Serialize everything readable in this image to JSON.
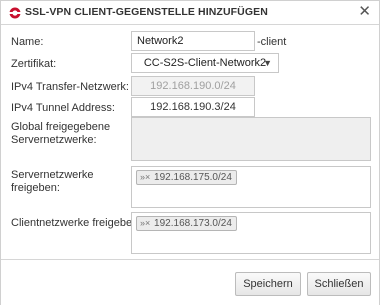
{
  "dialog": {
    "title": "SSL-VPN CLIENT-GEGENSTELLE HINZUFÜGEN",
    "close_symbol": "✕"
  },
  "form": {
    "name_label": "Name:",
    "name_value": "Network2",
    "name_suffix": "-client",
    "certificate_label": "Zertifikat:",
    "certificate_value": "CC-S2S-Client-Network2",
    "transfer_label": "IPv4 Transfer-Netzwerk:",
    "transfer_value": "192.168.190.0/24",
    "tunnel_label": "IPv4 Tunnel Address:",
    "tunnel_value": "192.168.190.3/24",
    "global_label": "Global freigegebene Servernetzwerke:",
    "server_label": "Servernetzwerke freigeben:",
    "server_tags": [
      {
        "remove": "»×",
        "value": "192.168.175.0/24"
      }
    ],
    "client_label": "Clientnetzwerke freigeben:",
    "client_tags": [
      {
        "remove": "»×",
        "value": "192.168.173.0/24"
      }
    ]
  },
  "footer": {
    "save_label": "Speichern",
    "close_label": "Schließen"
  },
  "colors": {
    "icon_red": "#c8102e",
    "border": "#c8c8c8"
  },
  "icons": {
    "title": "ssl-vpn-icon",
    "close": "close-icon",
    "dropdown": "chevron-down-icon"
  }
}
